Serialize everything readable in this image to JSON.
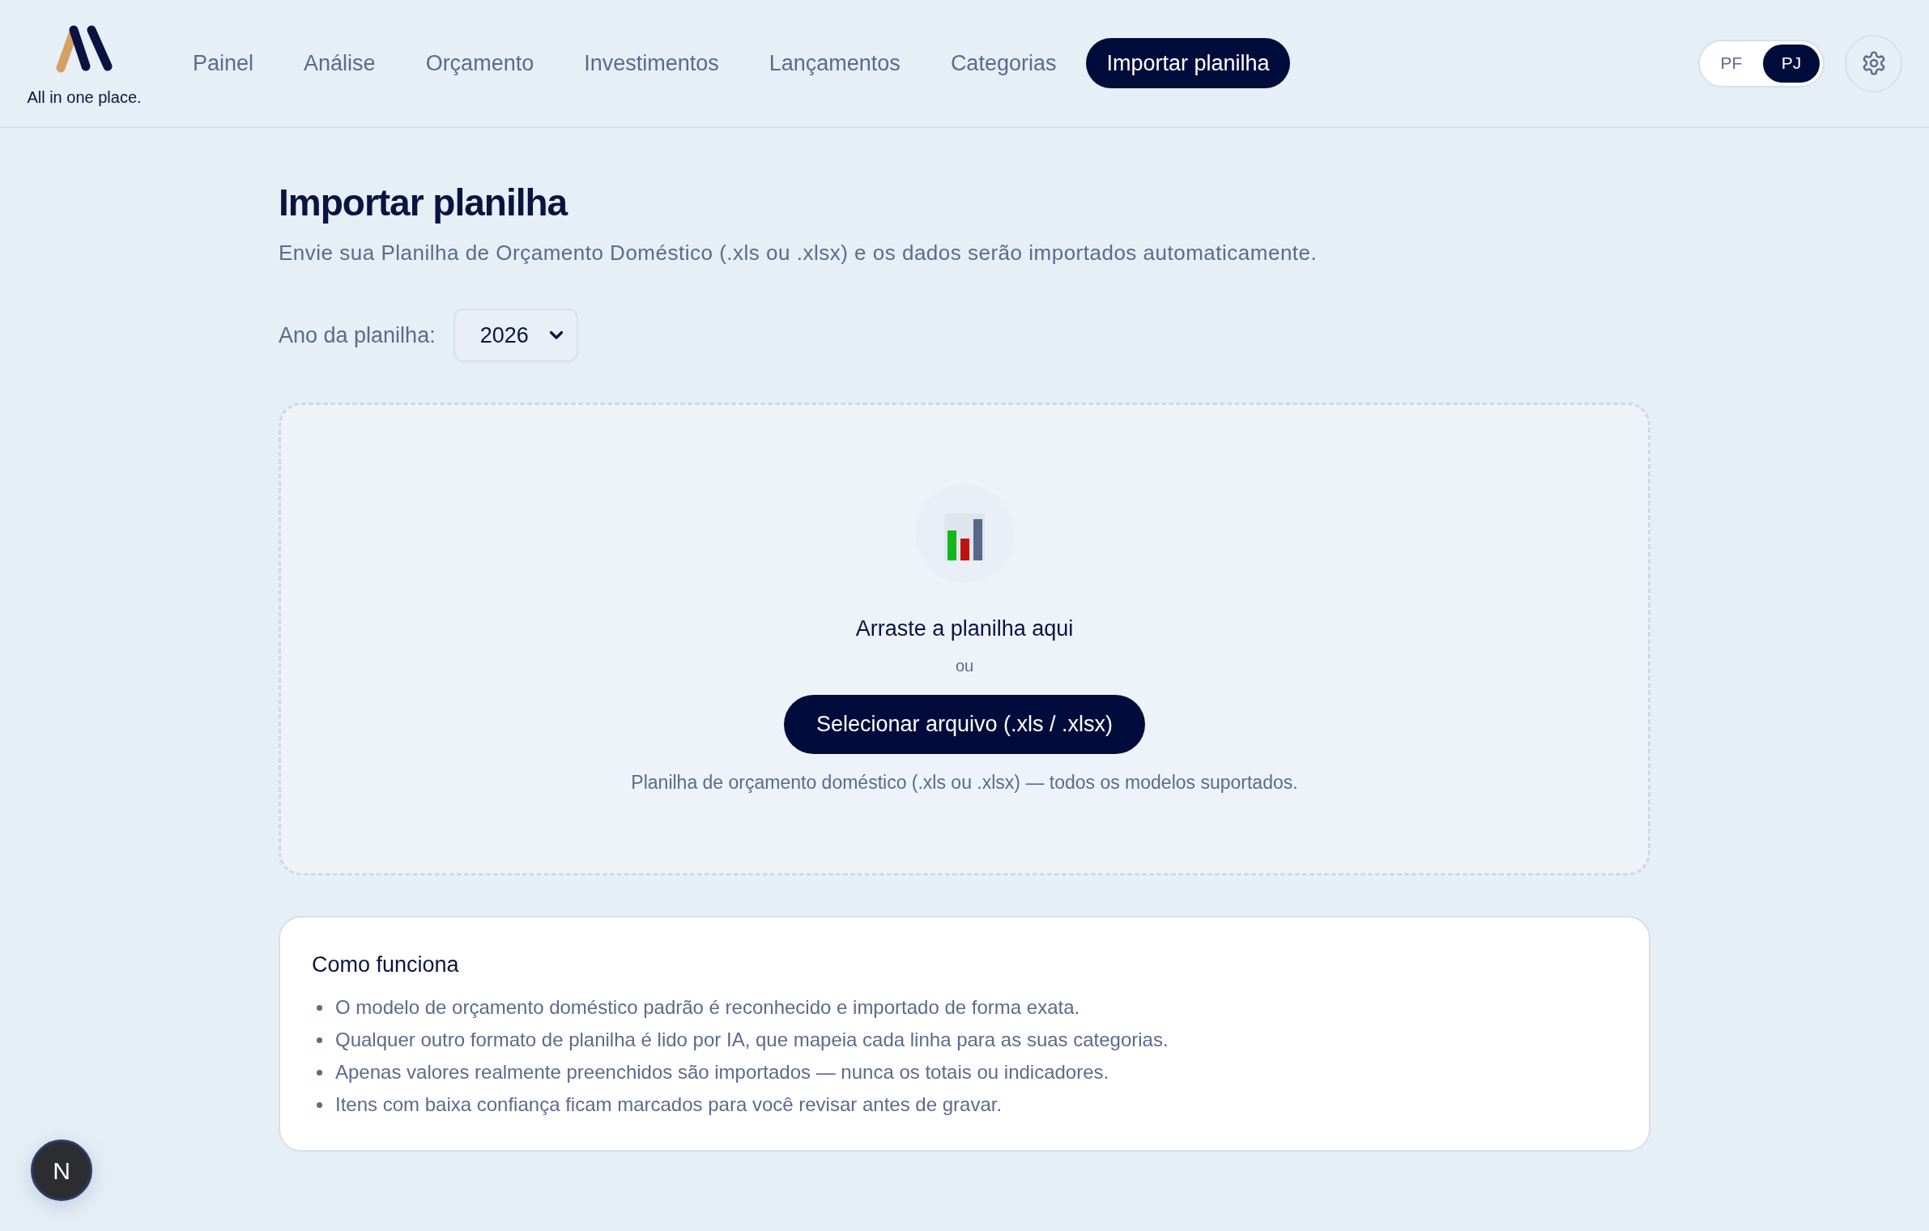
{
  "brand": {
    "tagline": "All in one place."
  },
  "nav": {
    "items": [
      {
        "label": "Painel",
        "selected": false
      },
      {
        "label": "Análise",
        "selected": false
      },
      {
        "label": "Orçamento",
        "selected": false
      },
      {
        "label": "Investimentos",
        "selected": false
      },
      {
        "label": "Lançamentos",
        "selected": false
      },
      {
        "label": "Categorias",
        "selected": false
      },
      {
        "label": "Importar planilha",
        "selected": true
      }
    ]
  },
  "profile_toggle": {
    "options": [
      {
        "label": "PF",
        "selected": false
      },
      {
        "label": "PJ",
        "selected": true
      }
    ]
  },
  "page": {
    "title": "Importar planilha",
    "subtitle": "Envie sua Planilha de Orçamento Doméstico (.xls ou .xlsx) e os dados serão importados automaticamente."
  },
  "year_select": {
    "label": "Ano da planilha:",
    "value": "2026"
  },
  "drop_zone": {
    "heading": "Arraste a planilha aqui",
    "separator": "ou",
    "button": "Selecionar arquivo (.xls / .xlsx)",
    "hint": "Planilha de orçamento doméstico (.xls ou .xlsx) — todos os modelos suportados."
  },
  "how_it_works": {
    "title": "Como funciona",
    "items": [
      "O modelo de orçamento doméstico padrão é reconhecido e importado de forma exata.",
      "Qualquer outro formato de planilha é lido por IA, que mapeia cada linha para as suas categorias.",
      "Apenas valores realmente preenchidos são importados — nunca os totais ou indicadores.",
      "Itens com baixa confiança ficam marcados para você revisar antes de gravar."
    ]
  },
  "dev_badge": {
    "label": "N"
  }
}
